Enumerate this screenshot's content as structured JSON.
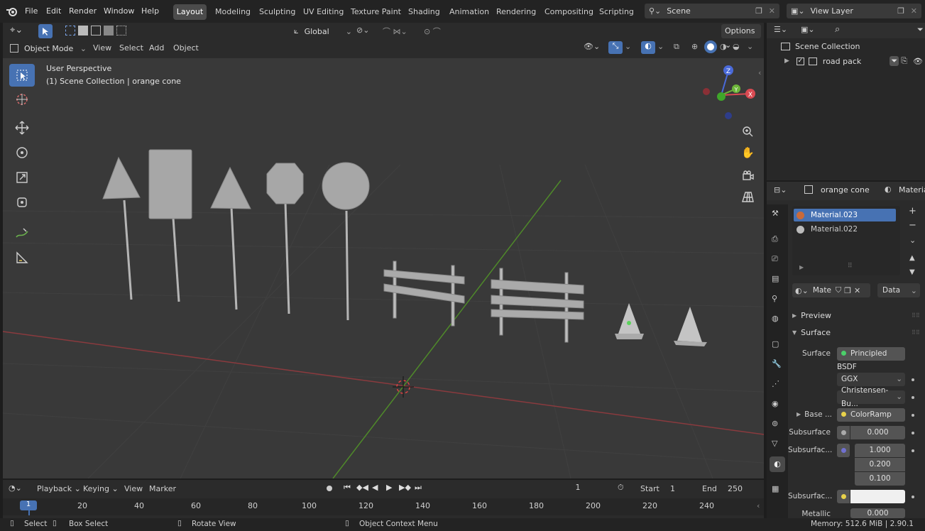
{
  "menu": {
    "items": [
      "File",
      "Edit",
      "Render",
      "Window",
      "Help"
    ],
    "workspaces": [
      "Layout",
      "Modeling",
      "Sculpting",
      "UV Editing",
      "Texture Paint",
      "Shading",
      "Animation",
      "Rendering",
      "Compositing",
      "Scripting"
    ],
    "scene_label": "Scene",
    "view_layer_label": "View Layer"
  },
  "viewport_header": {
    "transform_orientation": "Global",
    "options_label": "Options",
    "mode": "Object Mode",
    "menus": [
      "View",
      "Select",
      "Add",
      "Object"
    ]
  },
  "viewport": {
    "perspective_label": "User Perspective",
    "collection_label": "(1) Scene Collection | orange cone",
    "gizmo_axes": {
      "z": "Z",
      "y": "Y",
      "x": "X"
    }
  },
  "outliner": {
    "root": "Scene Collection",
    "children": [
      {
        "label": "road pack"
      }
    ]
  },
  "properties": {
    "object_name": "orange cone",
    "tab_name": "Materia",
    "materials": [
      "Material.023",
      "Material.022"
    ],
    "material_short": "Mate",
    "data_dropdown": "Data",
    "panels": {
      "preview": "Preview",
      "surface": "Surface"
    },
    "surface_label": "Surface",
    "surface_value": "Principled BSDF",
    "distribution": "GGX",
    "subsurface_method": "Christensen-Bu...",
    "base_label": "Base ...",
    "base_value": "ColorRamp",
    "subsurface_label": "Subsurface",
    "subsurface_value": "0.000",
    "subsurface_radius_label": "Subsurfac...",
    "subsurface_radius_values": [
      "1.000",
      "0.200",
      "0.100"
    ],
    "subsurface_color_label": "Subsurfac...",
    "metallic_label": "Metallic",
    "metallic_value": "0.000"
  },
  "timeline": {
    "menus": [
      "Playback",
      "Keying",
      "View",
      "Marker"
    ],
    "current_frame": "1",
    "start_label": "Start",
    "start_value": "1",
    "end_label": "End",
    "end_value": "250",
    "ruler_current": "1",
    "ruler_ticks": [
      "20",
      "40",
      "60",
      "80",
      "100",
      "120",
      "140",
      "160",
      "180",
      "200",
      "220",
      "240"
    ]
  },
  "statusbar": {
    "select": "Select",
    "box_select": "Box Select",
    "rotate_view": "Rotate View",
    "context_menu": "Object Context Menu",
    "memory": "Memory: 512.6 MiB | 2.90.1"
  },
  "colors": {
    "accent": "#4772b3",
    "axis_x": "#d94a52",
    "axis_y": "#6db63a",
    "axis_z": "#4a6ad9"
  }
}
